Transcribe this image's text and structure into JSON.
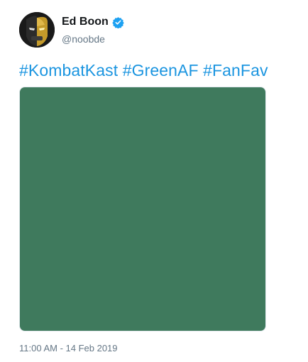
{
  "author": {
    "display_name": "Ed Boon",
    "handle": "@noobde",
    "verified_icon": "verified-badge-icon",
    "avatar_icon": "masked-face-avatar"
  },
  "tweet": {
    "hashtags": [
      "#KombatKast",
      "#GreenAF",
      "#FanFav"
    ],
    "media_color": "#3f7a5d",
    "timestamp": "11:00 AM - 14 Feb 2019"
  },
  "colors": {
    "link": "#1b95e0",
    "verified": "#1da1f2",
    "secondary_text": "#657786"
  }
}
